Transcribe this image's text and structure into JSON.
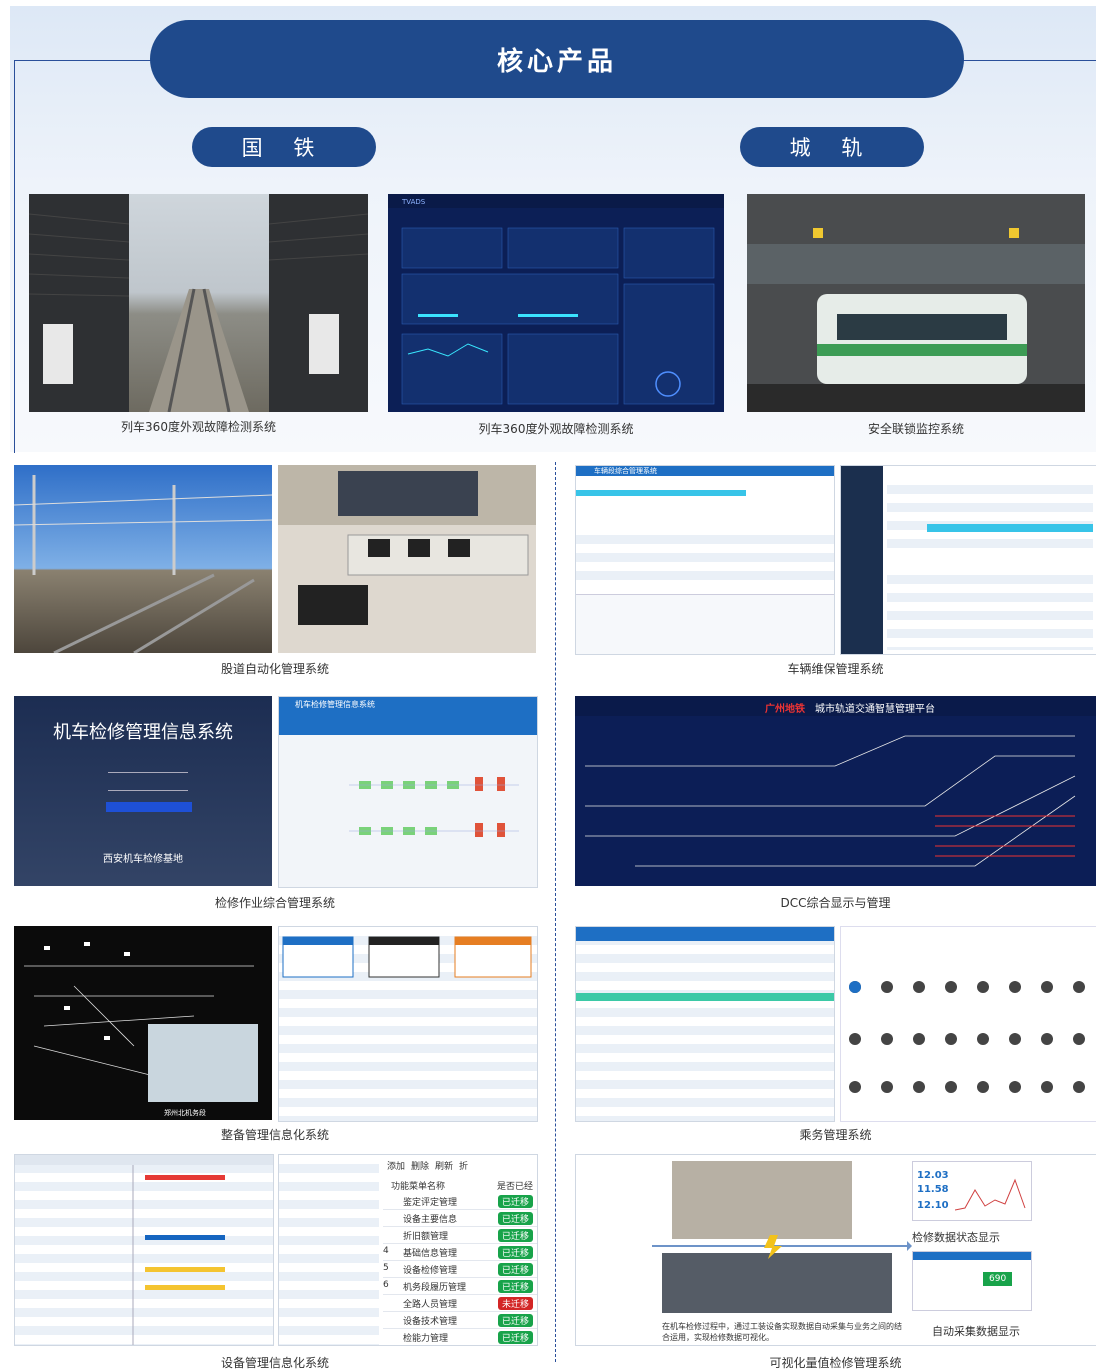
{
  "header": {
    "core_title": "核心产品",
    "left_category": "国 铁",
    "right_category": "城 轨"
  },
  "top_row": {
    "captions": [
      "列车360度外观故障检测系统",
      "列车360度外观故障检测系统",
      "安全联锁监控系统"
    ]
  },
  "sections": {
    "left": [
      {
        "caption": "股道自动化管理系统"
      },
      {
        "caption": "检修作业综合管理系统",
        "panel_title": "机车检修管理信息系统",
        "panel_subtitle": "西安机车检修基地",
        "app_title": "机车检修管理信息系统"
      },
      {
        "caption": "整备管理信息化系统",
        "map_label": "郑州北机务段"
      },
      {
        "caption": "设备管理信息化系统"
      }
    ],
    "right": [
      {
        "caption": "车辆维保管理系统",
        "app_title": "车辆段综合管理系统"
      },
      {
        "caption": "DCC综合显示与管理",
        "brand": "广州地铁",
        "platform_title": "城市轨道交通智慧管理平台"
      },
      {
        "caption": "乘务管理系统"
      },
      {
        "caption": "可视化量值检修管理系统"
      }
    ]
  },
  "equipment_menu": {
    "header": "功能菜单名称",
    "status_header": "是否已经",
    "toolbar": [
      "添加",
      "删除",
      "刷新",
      "折"
    ],
    "rows": [
      {
        "num": "",
        "name": "鉴定评定管理",
        "status": "已迁移"
      },
      {
        "num": "",
        "name": "设备主要信息",
        "status": "已迁移"
      },
      {
        "num": "",
        "name": "折旧额管理",
        "status": "已迁移"
      },
      {
        "num": "4",
        "name": "基础信息管理",
        "status": "已迁移"
      },
      {
        "num": "5",
        "name": "设备检修管理",
        "status": "已迁移"
      },
      {
        "num": "6",
        "name": "机务段履历管理",
        "status": "已迁移"
      },
      {
        "num": "",
        "name": "全路人员管理",
        "status": "未迁移"
      },
      {
        "num": "",
        "name": "设备技术管理",
        "status": "已迁移"
      },
      {
        "num": "",
        "name": "检能力管理",
        "status": "已迁移"
      }
    ]
  },
  "visual_repair": {
    "status_label": "检修数据状态显示",
    "collect_label": "自动采集数据显示",
    "description": "在机车检修过程中，通过工装设备实现数据自动采集与业务之间的结合运用，实现检修数据可视化。",
    "readings": [
      "12.03",
      "11.58",
      "12.10"
    ],
    "counter": "690"
  },
  "colors": {
    "brand_blue": "#1f4a8c",
    "accent_green": "#18a34a",
    "accent_red": "#d32626"
  }
}
